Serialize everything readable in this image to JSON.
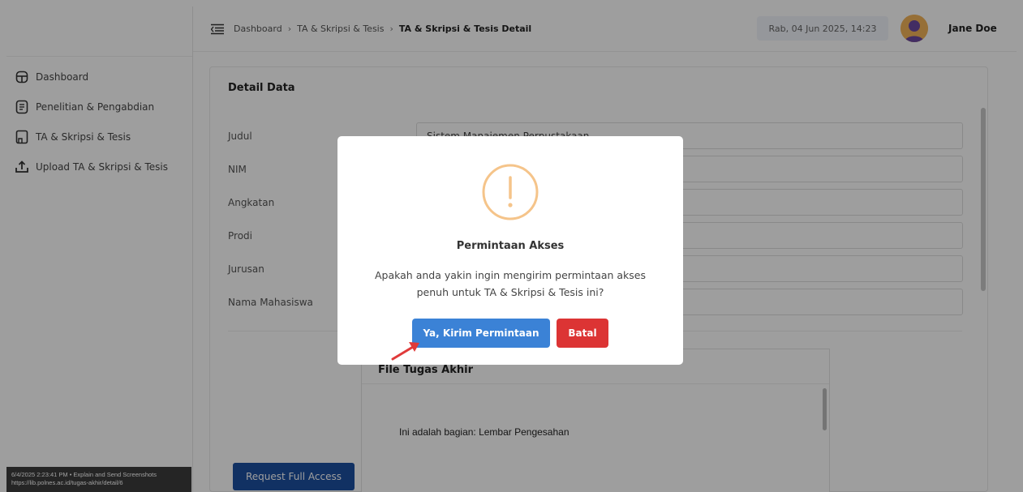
{
  "header": {
    "breadcrumb": [
      "Dashboard",
      "TA & Skripsi & Tesis",
      "TA & Skripsi & Tesis Detail"
    ],
    "separator": "›",
    "datetime": "Rab, 04 Jun 2025, 14:23",
    "user_name": "Jane Doe"
  },
  "sidebar": {
    "items": [
      {
        "label": "Dashboard",
        "icon": "dashboard-icon"
      },
      {
        "label": "Penelitian & Pengabdian",
        "icon": "document-icon"
      },
      {
        "label": "TA & Skripsi & Tesis",
        "icon": "book-icon"
      },
      {
        "label": "Upload TA & Skripsi & Tesis",
        "icon": "upload-icon"
      }
    ]
  },
  "detail": {
    "title": "Detail Data",
    "fields": [
      {
        "label": "Judul",
        "value": "Sistem Manajemen Perpustakaan"
      },
      {
        "label": "NIM",
        "value": ""
      },
      {
        "label": "Angkatan",
        "value": ""
      },
      {
        "label": "Prodi",
        "value": ""
      },
      {
        "label": "Jurusan",
        "value": ""
      },
      {
        "label": "Nama Mahasiswa",
        "value": ""
      }
    ],
    "file_section": {
      "title": "File Tugas Akhir",
      "content": "Ini adalah bagian: Lembar Pengesahan"
    },
    "request_button": "Request Full Access"
  },
  "modal": {
    "icon": "warning-icon",
    "title": "Permintaan Akses",
    "message_line1": "Apakah anda yakin ingin mengirim permintaan akses",
    "message_line2": "penuh untuk TA & Skripsi & Tesis ini?",
    "confirm_label": "Ya, Kirim Permintaan",
    "cancel_label": "Batal"
  },
  "screenshot_overlay": {
    "line1": "6/4/2025 2:23:41 PM • Explain and Send Screenshots",
    "line2": "https://lib.polnes.ac.id/tugas-akhir/detail/6"
  },
  "colors": {
    "primary": "#1c4fa0",
    "confirm": "#3b82d6",
    "cancel": "#dc3434",
    "warning": "#f5c48a"
  }
}
